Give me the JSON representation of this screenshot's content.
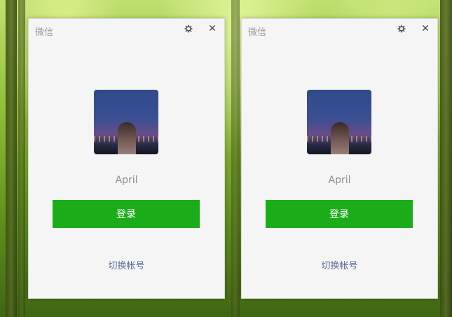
{
  "windows": [
    {
      "title": "微信",
      "username": "April",
      "login_label": "登录",
      "switch_account_label": "切换帐号",
      "settings_icon": "gear-icon",
      "close_icon": "close-icon",
      "close_glyph": "✕",
      "settings_glyph": "⚙"
    },
    {
      "title": "微信",
      "username": "April",
      "login_label": "登录",
      "switch_account_label": "切换帐号",
      "settings_icon": "gear-icon",
      "close_icon": "close-icon",
      "close_glyph": "✕",
      "settings_glyph": "⚙"
    }
  ],
  "colors": {
    "login_button": "#1aad19",
    "switch_link": "#576b95",
    "window_bg": "#f5f5f5"
  }
}
